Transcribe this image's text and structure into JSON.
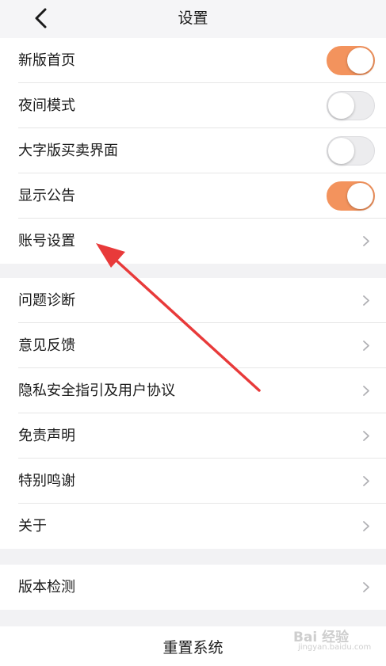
{
  "header": {
    "title": "设置"
  },
  "group1": {
    "items": [
      {
        "label": "新版首页",
        "control": "toggle",
        "on": true
      },
      {
        "label": "夜间模式",
        "control": "toggle",
        "on": false
      },
      {
        "label": "大字版买卖界面",
        "control": "toggle",
        "on": false
      },
      {
        "label": "显示公告",
        "control": "toggle",
        "on": true
      },
      {
        "label": "账号设置",
        "control": "chevron"
      }
    ]
  },
  "group2": {
    "items": [
      {
        "label": "问题诊断"
      },
      {
        "label": "意见反馈"
      },
      {
        "label": "隐私安全指引及用户协议"
      },
      {
        "label": "免责声明"
      },
      {
        "label": "特别鸣谢"
      },
      {
        "label": "关于"
      }
    ]
  },
  "group3": {
    "items": [
      {
        "label": "版本检测"
      }
    ]
  },
  "footer": {
    "reset_label": "重置系统"
  },
  "watermark": {
    "brand": "Bai 经验",
    "sub": "jingyan.baidu.com"
  },
  "colors": {
    "toggle_on": "#f3935d",
    "toggle_off": "#ececee",
    "annotation_arrow": "#e83a3a",
    "background": "#f2f2f4"
  },
  "icons": {
    "back": "chevron-left-icon",
    "row_arrow": "chevron-right-icon"
  }
}
